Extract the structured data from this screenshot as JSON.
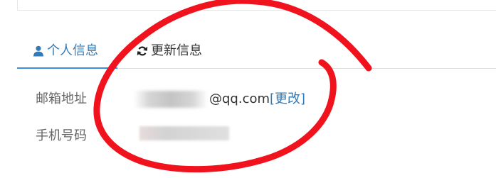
{
  "tabs": [
    {
      "label": "个人信息",
      "icon": "user-icon",
      "active": true
    },
    {
      "label": "更新信息",
      "icon": "refresh-icon",
      "active": false
    }
  ],
  "fields": {
    "email_label": "邮箱地址",
    "email_domain": "@qq.com",
    "email_edit": "[更改]",
    "phone_label": "手机号码"
  },
  "colors": {
    "active_tab": "#337ab7",
    "annotation": "#f0121c"
  }
}
